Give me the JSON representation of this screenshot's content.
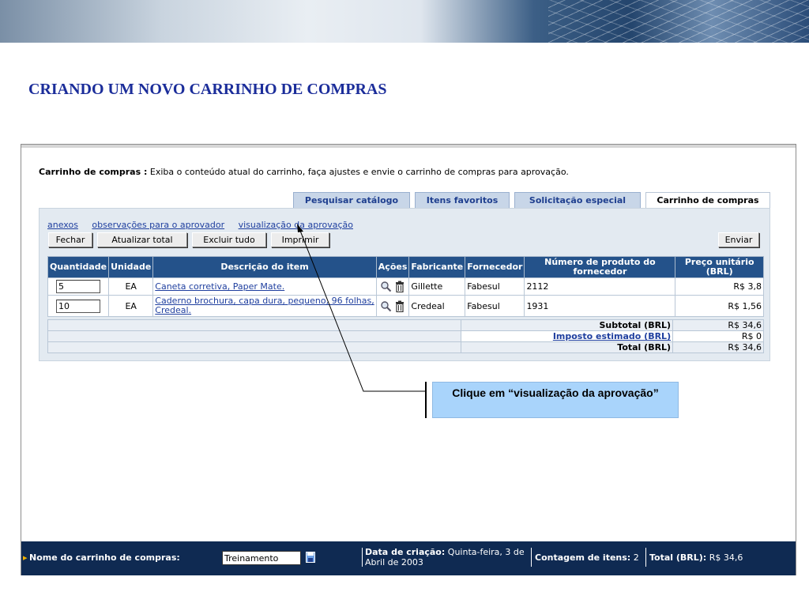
{
  "slide": {
    "title": "CRIANDO UM NOVO CARRINHO DE COMPRAS"
  },
  "cart": {
    "heading_label": "Carrinho de compras :",
    "heading_desc": "Exiba o conteúdo atual do carrinho, faça ajustes e envie o carrinho de compras para aprovação."
  },
  "tabs": [
    {
      "label": "Pesquisar catálogo",
      "active": false
    },
    {
      "label": "Itens favoritos",
      "active": false
    },
    {
      "label": "Solicitação especial",
      "active": false
    },
    {
      "label": "Carrinho de compras",
      "active": true
    }
  ],
  "links": {
    "attachments": "anexos",
    "notes": "observações para o aprovador",
    "approval_view": "visualização da aprovação"
  },
  "buttons": {
    "close": "Fechar",
    "update_total": "Atualizar total",
    "delete_all": "Excluir tudo",
    "print": "Imprimir",
    "send": "Enviar"
  },
  "table": {
    "headers": {
      "qty": "Quantidade",
      "unit": "Unidade",
      "desc": "Descrição do item",
      "actions": "Ações",
      "maker": "Fabricante",
      "supplier": "Fornecedor",
      "part_no": "Número de produto do fornecedor",
      "price": "Preço unitário (BRL)"
    },
    "rows": [
      {
        "qty": "5",
        "unit": "EA",
        "desc": "Caneta corretiva, Paper Mate.",
        "maker": "Gillette",
        "supplier": "Fabesul",
        "part_no": "2112",
        "price": "R$ 3,8"
      },
      {
        "qty": "10",
        "unit": "EA",
        "desc": "Caderno brochura, capa dura, pequeno, 96 folhas, Credeal.",
        "maker": "Credeal",
        "supplier": "Fabesul",
        "part_no": "1931",
        "price": "R$ 1,56"
      }
    ]
  },
  "totals": {
    "subtotal_label": "Subtotal (BRL)",
    "subtotal_value": "R$ 34,6",
    "tax_label": "Imposto estimado (BRL)",
    "tax_value": "R$ 0",
    "total_label": "Total (BRL)",
    "total_value": "R$ 34,6"
  },
  "callout": {
    "text": "Clique em “visualização da aprovação”"
  },
  "footer": {
    "cart_name_label": "Nome do carrinho de compras:",
    "cart_name_value": "Treinamento",
    "created_label": "Data de criação:",
    "created_value": "Quinta-feira, 3 de",
    "created_value2": "Abril de 2003",
    "count_label": "Contagem de itens:",
    "count_value": "2",
    "total_label": "Total (BRL):",
    "total_value": "R$ 34,6"
  },
  "colors": {
    "header_blue": "#24528a",
    "footer_navy": "#0f2a52",
    "link_blue": "#1f3f9f",
    "callout_blue": "#a9d4fb",
    "title_blue": "#1b2d9a"
  }
}
